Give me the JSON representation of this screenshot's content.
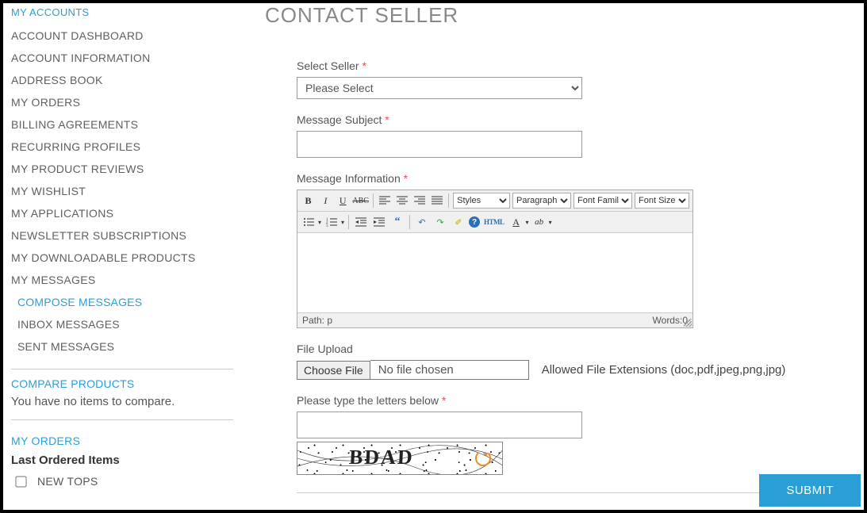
{
  "sidebar": {
    "heading": "MY ACCOUNTS",
    "items": [
      "ACCOUNT DASHBOARD",
      "ACCOUNT INFORMATION",
      "ADDRESS BOOK",
      "MY ORDERS",
      "BILLING AGREEMENTS",
      "RECURRING PROFILES",
      "MY PRODUCT REVIEWS",
      "MY WISHLIST",
      "MY APPLICATIONS",
      "NEWSLETTER SUBSCRIPTIONS",
      "MY DOWNLOADABLE PRODUCTS",
      "MY MESSAGES"
    ],
    "sub_items": [
      "COMPOSE MESSAGES",
      "INBOX MESSAGES",
      "SENT MESSAGES"
    ],
    "compare_title": "COMPARE PRODUCTS",
    "compare_text": "You have no items to compare.",
    "orders_title": "MY ORDERS",
    "last_ordered_heading": "Last Ordered Items",
    "last_ordered_item": "NEW TOPS"
  },
  "page": {
    "title": "CONTACT SELLER"
  },
  "form": {
    "seller_label": "Select Seller",
    "seller_placeholder": "Please Select",
    "subject_label": "Message Subject",
    "info_label": "Message Information",
    "file_label": "File Upload",
    "file_button": "Choose File",
    "file_chosen": "No file chosen",
    "file_hint": "Allowed File Extensions (doc,pdf,jpeg,png,jpg)",
    "captcha_label": "Please type the letters below",
    "captcha_text": "BDAD",
    "submit": "SUBMIT"
  },
  "editor": {
    "styles": "Styles",
    "paragraph": "Paragraph",
    "font_family": "Font Family",
    "font_size": "Font Size",
    "path": "Path: p",
    "words": "Words:0",
    "html": "HTML"
  }
}
